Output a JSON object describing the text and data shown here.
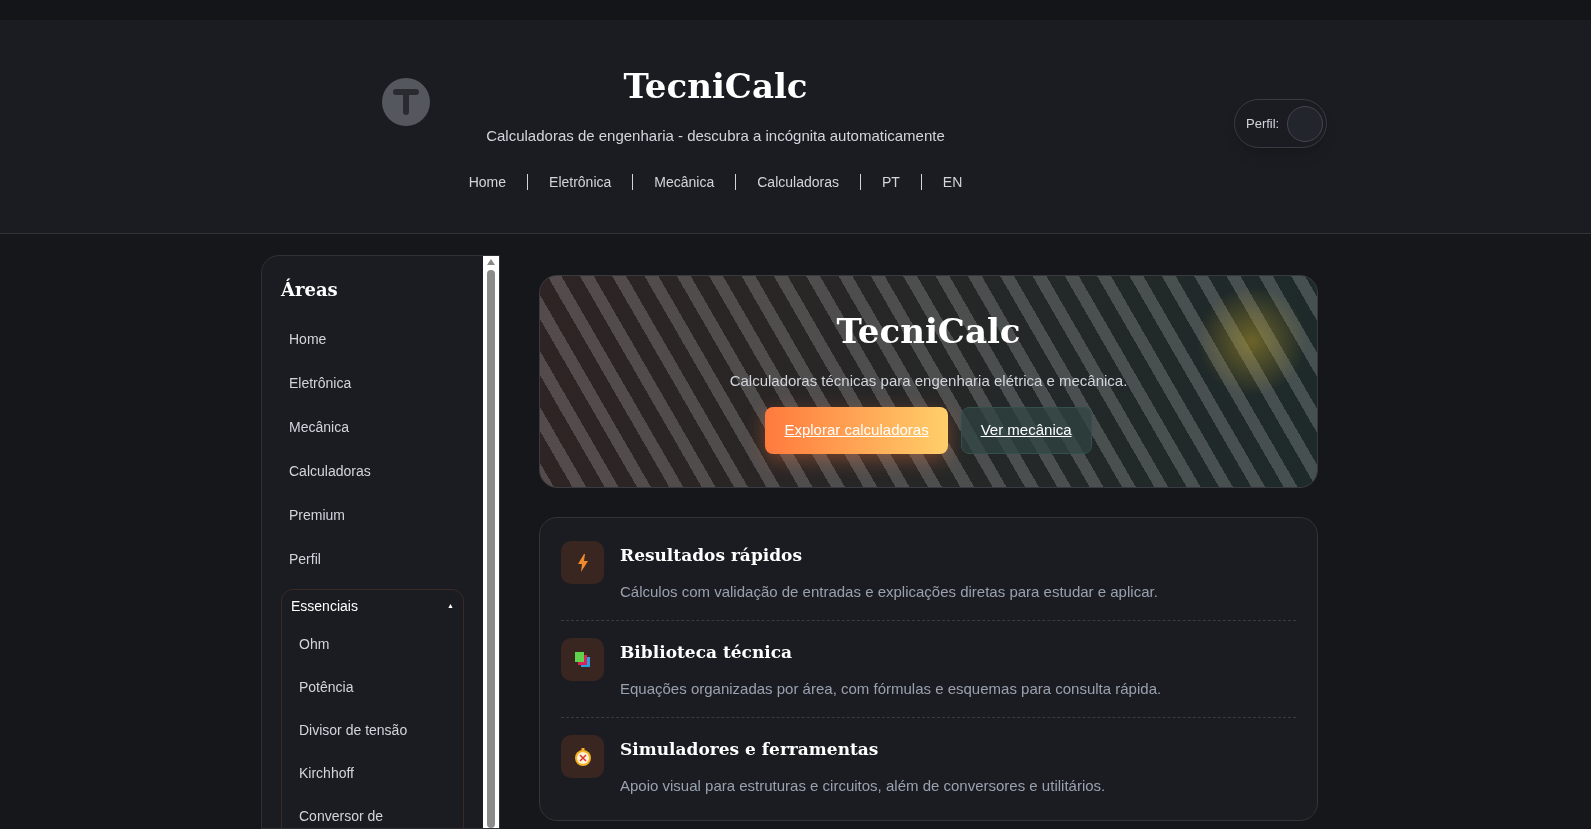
{
  "header": {
    "title": "TecniCalc",
    "subtitle": "Calculadoras de engenharia - descubra a incógnita automaticamente",
    "nav": [
      "Home",
      "Eletrônica",
      "Mecânica",
      "Calculadoras",
      "PT",
      "EN"
    ],
    "profile_label": "Perfil:"
  },
  "sidebar": {
    "title": "Áreas",
    "items": [
      "Home",
      "Eletrônica",
      "Mecânica",
      "Calculadoras",
      "Premium",
      "Perfil"
    ],
    "group": {
      "label": "Essenciais",
      "expanded": true,
      "caret": "▲",
      "items": [
        "Ohm",
        "Potência",
        "Divisor de tensão",
        "Kirchhoff",
        "Conversor de"
      ]
    }
  },
  "hero": {
    "title": "TecniCalc",
    "text": "Calculadoras técnicas para engenharia elétrica e mecânica.",
    "buttons": [
      {
        "label": "Explorar calculadoras",
        "kind": "primary"
      },
      {
        "label": "Ver mecânica",
        "kind": "secondary"
      }
    ]
  },
  "features": [
    {
      "kind": "bolt",
      "title": "Resultados rápidos",
      "text": "Cálculos com validação de entradas e explicações diretas para estudar e aplicar."
    },
    {
      "kind": "books",
      "title": "Biblioteca técnica",
      "text": "Equações organizadas por área, com fórmulas e esquemas para consulta rápida."
    },
    {
      "kind": "compass",
      "title": "Simuladores e ferramentas",
      "text": "Apoio visual para estruturas e circuitos, além de conversores e utilitários."
    }
  ]
}
